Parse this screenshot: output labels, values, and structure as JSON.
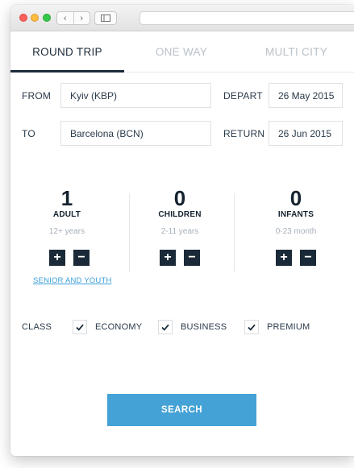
{
  "tabs": [
    {
      "label": "ROUND TRIP"
    },
    {
      "label": "ONE WAY"
    },
    {
      "label": "MULTI CITY"
    }
  ],
  "form": {
    "from_label": "FROM",
    "from_value": "Kyiv (KBP)",
    "to_label": "TO",
    "to_value": "Barcelona (BCN)",
    "depart_label": "DEPART",
    "depart_value": "26 May 2015",
    "return_label": "RETURN",
    "return_value": "26 Jun 2015"
  },
  "passengers": [
    {
      "count": "1",
      "type": "ADULT",
      "range": "12+ years"
    },
    {
      "count": "0",
      "type": "CHILDREN",
      "range": "2-11 years"
    },
    {
      "count": "0",
      "type": "INFANTS",
      "range": "0-23 month"
    }
  ],
  "stepper": {
    "plus": "+",
    "minus": "−"
  },
  "senior_link": "SENIOR AND YOUTH",
  "class": {
    "label": "CLASS",
    "options": [
      {
        "label": "ECONOMY",
        "checked": true
      },
      {
        "label": "BUSINESS",
        "checked": true
      },
      {
        "label": "PREMIUM",
        "checked": true
      }
    ]
  },
  "search_label": "SEARCH",
  "browser": {
    "back_glyph": "‹",
    "forward_glyph": "›"
  },
  "colors": {
    "accent": "#45a2d6",
    "dark": "#1b2a38",
    "link": "#3b9fd9",
    "inactive_tab": "#b9c1c9"
  }
}
